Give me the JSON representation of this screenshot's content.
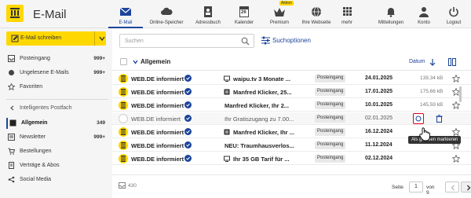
{
  "app": {
    "logo_text": "E-Mail"
  },
  "topnav": [
    {
      "label": "E-Mail",
      "icon": "mail-icon",
      "active": true
    },
    {
      "label": "Online-Speicher",
      "icon": "cloud-icon"
    },
    {
      "label": "Adressbuch",
      "icon": "address-book-icon"
    },
    {
      "label": "Kalender",
      "icon": "calendar-icon",
      "icon_text": "26"
    },
    {
      "label": "Premium",
      "icon": "premium-icon",
      "badge": "Aktion"
    },
    {
      "label": "Ihre Webseite",
      "icon": "globe-icon"
    },
    {
      "label": "mehr",
      "icon": "apps-grid-icon"
    },
    {
      "label": "Mitteilungen",
      "icon": "bell-icon"
    },
    {
      "label": "Konto",
      "icon": "account-icon"
    },
    {
      "label": "Logout",
      "icon": "power-icon"
    }
  ],
  "sidebar": {
    "compose_label": "E-Mail schreiben",
    "folders": [
      {
        "label": "Posteingang",
        "count": "999+",
        "icon": "inbox-icon"
      },
      {
        "label": "Ungelesene E-Mails",
        "count": "999+",
        "icon": "unread-icon"
      },
      {
        "label": "Favoriten",
        "count": "",
        "icon": "star-icon"
      }
    ],
    "section_label": "Intelligentes Postfach",
    "smart": [
      {
        "label": "Allgemein",
        "count": "349",
        "icon": "general-icon",
        "active": true
      },
      {
        "label": "Newsletter",
        "count": "999+",
        "icon": "newsletter-icon"
      },
      {
        "label": "Bestellungen",
        "count": "",
        "icon": "cart-icon"
      },
      {
        "label": "Verträge & Abos",
        "count": "",
        "icon": "contract-icon"
      },
      {
        "label": "Social Media",
        "count": "",
        "icon": "social-icon"
      }
    ]
  },
  "search": {
    "placeholder": "Suchen"
  },
  "search_options_label": "Suchoptionen",
  "list": {
    "title": "Allgemein",
    "sort_label": "Datum",
    "rows": [
      {
        "from": "WEB.DE informiert",
        "subject": "waipu.tv 3 Monate ...",
        "folder": "Posteingang",
        "date": "24.01.2025",
        "size": "139,34 kB",
        "unread": true,
        "type": "tv"
      },
      {
        "from": "WEB.DE informiert",
        "subject": "Manfred Klicker, 25...",
        "folder": "Posteingang",
        "date": "17.01.2025",
        "size": "175,66 kB",
        "unread": true,
        "type": "newsletter"
      },
      {
        "from": "WEB.DE informiert",
        "subject": "Manfred Klicker, Ihr 2...",
        "folder": "Posteingang",
        "date": "10.01.2025",
        "size": "145,59 kB",
        "unread": true,
        "type": "none"
      },
      {
        "from": "WEB.DE informiert",
        "subject": "Ihr Gratiszugang zu 7.00...",
        "folder": "Posteingang",
        "date": "02.01.2025",
        "size": "",
        "unread": false,
        "type": "none",
        "selected": true
      },
      {
        "from": "WEB.DE informiert",
        "subject": "Manfred Klicker, Ihr ...",
        "folder": "Posteingang",
        "date": "16.12.2024",
        "size": "",
        "unread": true,
        "type": "newsletter"
      },
      {
        "from": "WEB.DE informiert",
        "subject": "NEU: Traumhausverlos...",
        "folder": "Posteingang",
        "date": "11.12.2024",
        "size": "",
        "unread": true,
        "type": "none"
      },
      {
        "from": "WEB.DE informiert",
        "subject": "Ihr 35 GB Tarif für ...",
        "folder": "Posteingang",
        "date": "02.12.2024",
        "size": "",
        "unread": true,
        "type": "tv"
      }
    ],
    "tooltip": "Als gelesen markieren"
  },
  "footer": {
    "count": "430",
    "page_label": "Seite",
    "page": "1",
    "of_label": "von 9"
  },
  "colors": {
    "brand": "#ffd800",
    "accent": "#1c449b",
    "highlight": "#e2001a"
  }
}
